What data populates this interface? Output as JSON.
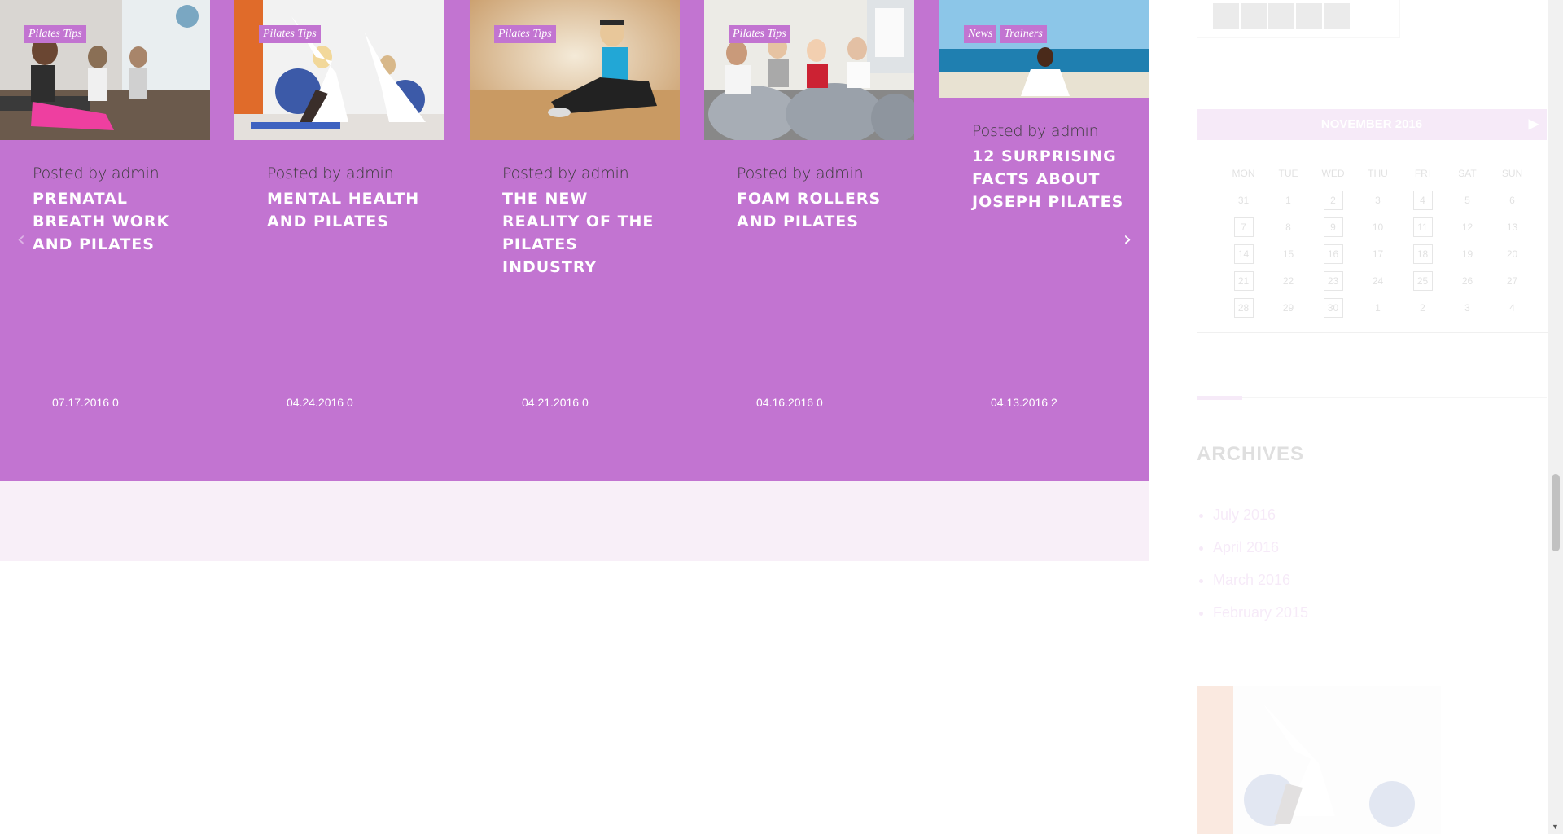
{
  "carousel": {
    "posts": [
      {
        "tags": [
          "Pilates Tips"
        ],
        "author": "Posted by admin",
        "title": "Prenatal Breath Work and Pilates",
        "date": "07.17.2016",
        "comments": "0"
      },
      {
        "tags": [
          "Pilates Tips"
        ],
        "author": "Posted by admin",
        "title": "Mental Health and Pilates",
        "date": "04.24.2016",
        "comments": "0"
      },
      {
        "tags": [
          "Pilates Tips"
        ],
        "author": "Posted by admin",
        "title": "The New Reality of the Pilates Industry",
        "date": "04.21.2016",
        "comments": "0"
      },
      {
        "tags": [
          "Pilates Tips"
        ],
        "author": "Posted by admin",
        "title": "Foam Rollers and Pilates",
        "date": "04.16.2016",
        "comments": "0"
      },
      {
        "tags": [
          "News",
          "Trainers"
        ],
        "author": "Posted by admin",
        "title": "12 Surprising Facts About Joseph Pilates",
        "date": "04.13.2016",
        "comments": "2"
      }
    ],
    "prev_icon": "chevron-left-icon",
    "next_icon": "chevron-right-icon",
    "accent_color": "#c274d1"
  },
  "sidebar": {
    "calendar": {
      "month": "NOVEMBER 2016",
      "next_icon": "arrow-right-icon",
      "weekdays": [
        "MON",
        "TUE",
        "WED",
        "THU",
        "FRI",
        "SAT",
        "SUN"
      ],
      "weeks": [
        [
          "31",
          "1",
          "2",
          "3",
          "4",
          "5",
          "6"
        ],
        [
          "7",
          "8",
          "9",
          "10",
          "11",
          "12",
          "13"
        ],
        [
          "14",
          "15",
          "16",
          "17",
          "18",
          "19",
          "20"
        ],
        [
          "21",
          "22",
          "23",
          "24",
          "25",
          "26",
          "27"
        ],
        [
          "28",
          "29",
          "30",
          "1",
          "2",
          "3",
          "4"
        ]
      ],
      "linked_days": [
        "2",
        "4",
        "7",
        "9",
        "11",
        "14",
        "16",
        "18",
        "21",
        "23",
        "25",
        "28",
        "30"
      ]
    },
    "archives": {
      "title": "ARCHIVES",
      "items": [
        "July 2016",
        "April 2016",
        "March 2016",
        "February 2015"
      ]
    }
  }
}
